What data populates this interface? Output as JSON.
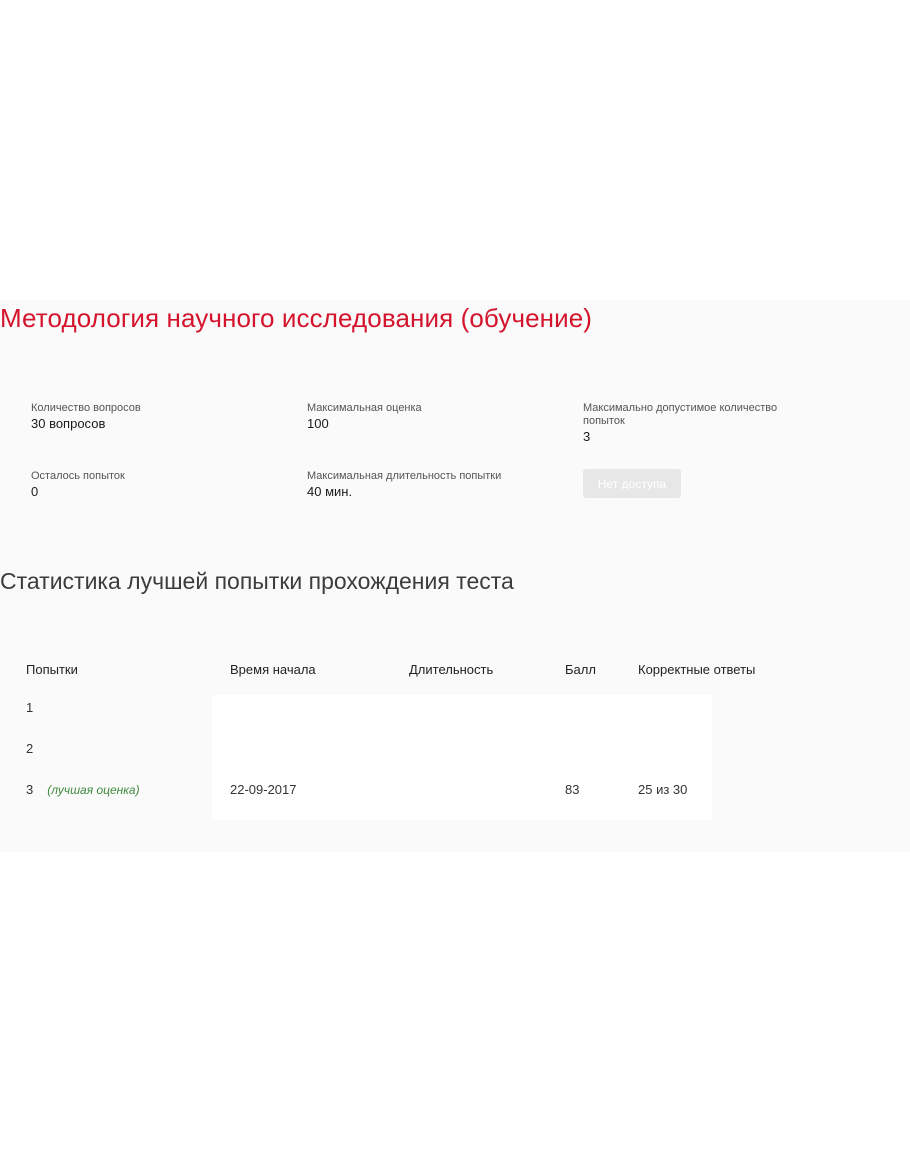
{
  "title": "Методология научного исследования (обучение)",
  "info": {
    "questions_label": "Количество вопросов",
    "questions_value": "30 вопросов",
    "max_score_label": "Максимальная оценка",
    "max_score_value": "100",
    "max_attempts_label": "Максимально допустимое количество попыток",
    "max_attempts_value": "3",
    "attempts_left_label": "Осталось попыток",
    "attempts_left_value": "0",
    "max_duration_label": "Максимальная длительность попытки",
    "max_duration_value": "40 мин."
  },
  "action_button_label": "Нет доступа",
  "stats": {
    "title": "Статистика лучшей попытки прохождения теста",
    "columns": [
      "Попытки",
      "Время начала",
      "Длительность",
      "Балл",
      "Корректные ответы"
    ],
    "rows": [
      {
        "attempt": "1",
        "note": "",
        "start": "",
        "duration": "",
        "score": "",
        "correct": ""
      },
      {
        "attempt": "2",
        "note": "",
        "start": "",
        "duration": "",
        "score": "",
        "correct": ""
      },
      {
        "attempt": "3",
        "note": "(лучшая оценка)",
        "start": "22-09-2017",
        "duration": "",
        "score": "83",
        "correct": "25 из 30"
      }
    ]
  },
  "colors": {
    "title": "#d4142c",
    "best_note": "#3f8a3f",
    "button_bg": "#e7e7e7"
  }
}
